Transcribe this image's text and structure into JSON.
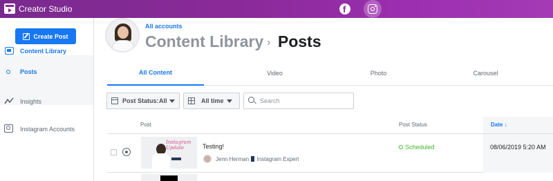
{
  "app": {
    "title": "Creator Studio"
  },
  "topnav": {
    "facebook_icon": "facebook-icon",
    "instagram_icon": "instagram-icon"
  },
  "sidebar": {
    "create_label": "Create Post",
    "items": [
      {
        "label": "Content Library",
        "icon": "library-icon",
        "active": true
      },
      {
        "label": "Posts",
        "icon": "dot-icon",
        "active": true
      },
      {
        "label": "Insights",
        "icon": "insights-icon",
        "active": false
      },
      {
        "label": "Instagram Accounts",
        "icon": "instagram-accounts-icon",
        "active": false
      }
    ]
  },
  "header": {
    "all_accounts": "All accounts",
    "crumb_root": "Content Library",
    "crumb_sep": "›",
    "crumb_current": "Posts"
  },
  "tabs": [
    "All Content",
    "Video",
    "Photo",
    "Carousel"
  ],
  "filters": {
    "status_label": "Post Status:",
    "status_value": "All",
    "time_value": "All time",
    "search_placeholder": "Search"
  },
  "table": {
    "headers": {
      "post": "Post",
      "status": "Post Status",
      "date": "Date ↓"
    },
    "rows": [
      {
        "title": "Testing!",
        "author": "Jenn Herman",
        "author_role": "Instagram Expert",
        "thumb_text": "Instagram Update",
        "status": "Scheduled",
        "date": "08/06/2019 5:20 AM"
      }
    ]
  },
  "colors": {
    "accent": "#1877f2",
    "topbar": "#8b2a9a",
    "success": "#42b72a"
  }
}
